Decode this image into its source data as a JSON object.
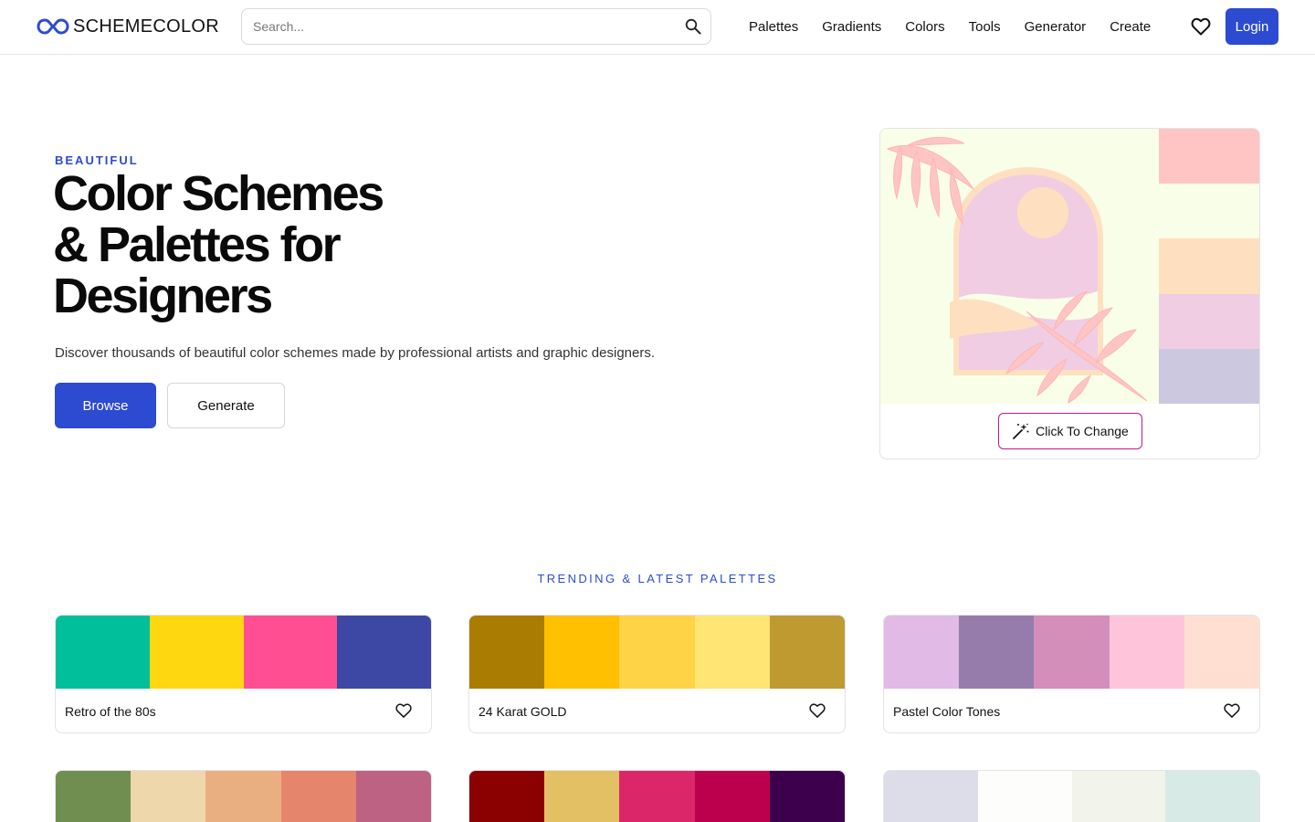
{
  "header": {
    "logo_text": "SCHEMECOLOR",
    "search_placeholder": "Search...",
    "nav": [
      "Palettes",
      "Gradients",
      "Colors",
      "Tools",
      "Generator",
      "Create"
    ],
    "login_label": "Login",
    "icons": {
      "logo": "infinity-logo-icon",
      "search": "search-icon",
      "favorites": "heart-icon"
    }
  },
  "hero": {
    "eyebrow": "BEAUTIFUL",
    "title_lines": [
      "Color Schemes",
      "& Palettes for",
      "Designers"
    ],
    "subtitle": "Discover thousands of beautiful color schemes made by professional artists and graphic designers.",
    "browse_label": "Browse",
    "generate_label": "Generate",
    "card": {
      "change_label": "Click To Change",
      "change_icon": "magic-wand-icon",
      "colors": [
        "#FFC5C5",
        "#F8FEE8",
        "#FEE0C0",
        "#F0CDE2",
        "#CCC8DF"
      ]
    }
  },
  "trending": {
    "label": "TRENDING & LATEST PALETTES",
    "palettes": [
      {
        "name": "Retro of the 80s",
        "colors": [
          "#00BF9A",
          "#FFD711",
          "#FF4F92",
          "#3D47A4"
        ]
      },
      {
        "name": "24 Karat GOLD",
        "colors": [
          "#AA7C01",
          "#FEC000",
          "#FED346",
          "#FEE574",
          "#BE9A31"
        ]
      },
      {
        "name": "Pastel Color Tones",
        "colors": [
          "#E1BAE5",
          "#967CAB",
          "#D38FBA",
          "#FEC5DA",
          "#FFDFD1"
        ]
      },
      {
        "name": "",
        "colors": [
          "#718E51",
          "#EFD7AC",
          "#EAAF80",
          "#E5856C",
          "#BD6282"
        ]
      },
      {
        "name": "",
        "colors": [
          "#8B0000",
          "#E3C064",
          "#DB2769",
          "#BC004D",
          "#3D004D"
        ]
      },
      {
        "name": "",
        "colors": [
          "#DCDDE8",
          "#FDFDFB",
          "#F2F4EC",
          "#D8EAE5"
        ]
      }
    ]
  },
  "colors": {
    "accent": "#2C4BD1",
    "change_border": "#C2188F"
  }
}
